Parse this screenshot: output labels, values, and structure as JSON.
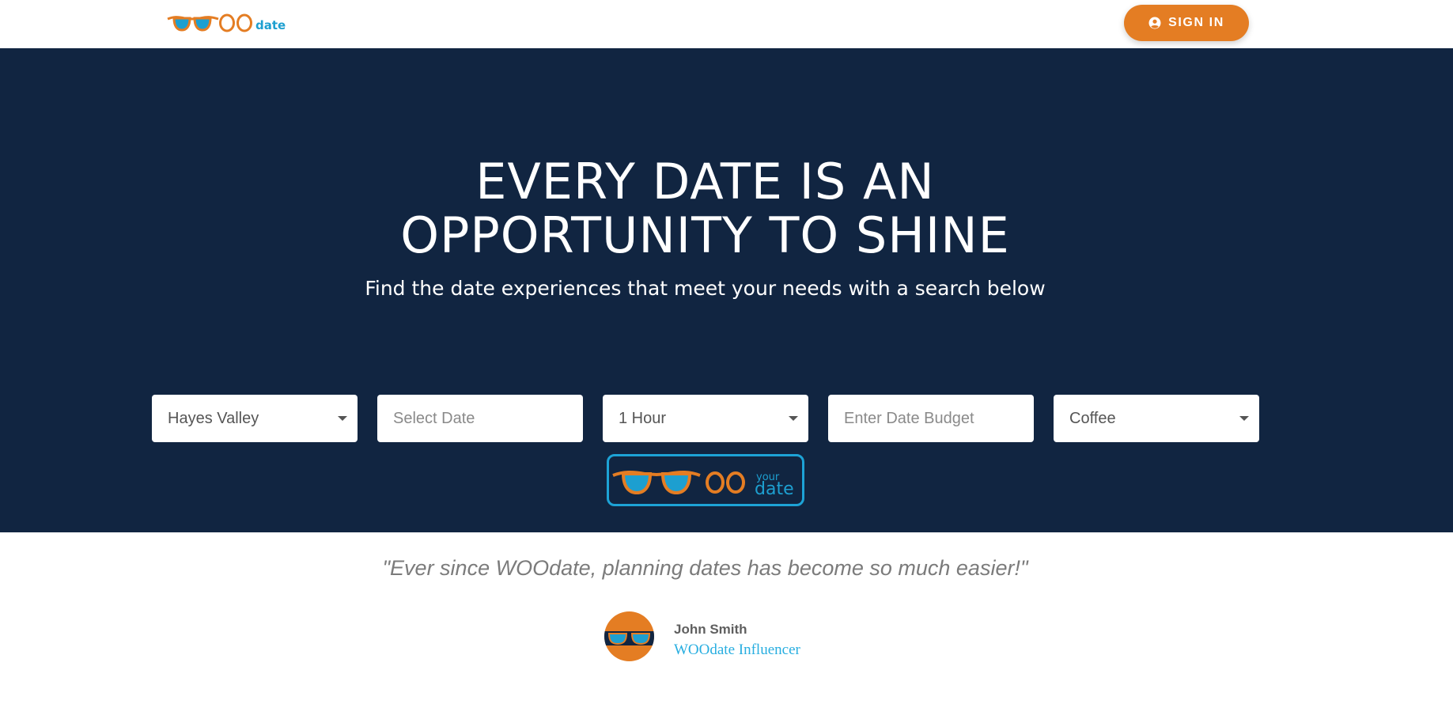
{
  "header": {
    "logo_text": "OOdate",
    "logo_word": "date",
    "signin_label": "SIGN IN"
  },
  "hero": {
    "headline_line1": "EVERY DATE IS AN",
    "headline_line2": "OPPORTUNITY TO SHINE",
    "subheadline": "Find the date experiences that meet your needs with a search below"
  },
  "search": {
    "neighborhood": {
      "value": "Hayes Valley"
    },
    "date": {
      "placeholder": "Select Date"
    },
    "duration": {
      "value": "1 Hour"
    },
    "budget": {
      "placeholder": "Enter Date Budget"
    },
    "category": {
      "value": "Coffee"
    },
    "submit_logo": {
      "text": "OO",
      "small_word": "your",
      "word": "date"
    }
  },
  "testimonial": {
    "quote": "\"Ever since WOOdate, planning dates has become so much easier!\"",
    "name": "John Smith",
    "role": "WOOdate Influencer"
  },
  "colors": {
    "navy": "#112541",
    "orange": "#e47d23",
    "blue": "#1da3d6"
  },
  "icons": {
    "signin": "user-circle-icon",
    "logo": "sunglasses-icon",
    "dropdown": "caret-down-icon"
  }
}
